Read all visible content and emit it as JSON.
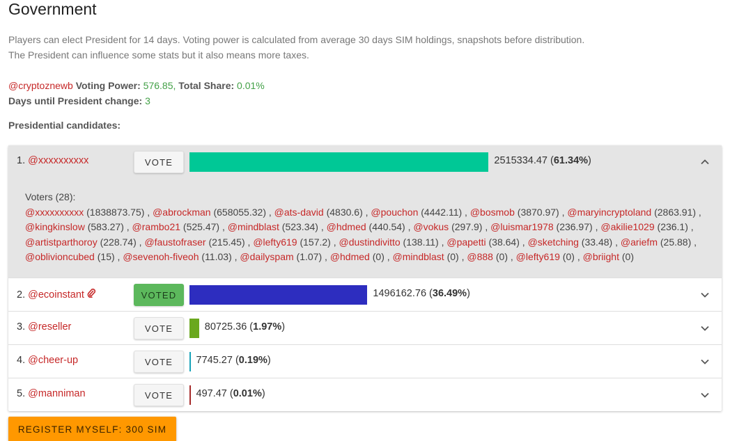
{
  "title": "Government",
  "description": {
    "line1": "Players can elect President for 14 days. Voting power is calculated from average 30 days SIM holdings, snapshots before distribution.",
    "line2": "The President can influence some stats but it also means more taxes."
  },
  "user": {
    "name": "@cryptoznewb",
    "voting_power_label": "Voting Power:",
    "voting_power": "576.85",
    "total_share_label": "Total Share:",
    "total_share": "0.01%",
    "days_label": "Days until President change:",
    "days": "3"
  },
  "candidates_label": "Presidential candidates:",
  "candidates": [
    {
      "rank": "1.",
      "name": "@xxxxxxxxxx",
      "button": "VOTE",
      "voted": false,
      "votes": "2515334.47",
      "pct": "61.34%",
      "share": 0.6134,
      "color": "#00c896",
      "expanded": true
    },
    {
      "rank": "2.",
      "name": "@ecoinstant",
      "button": "VOTED",
      "voted": true,
      "votes": "1496162.76",
      "pct": "36.49%",
      "share": 0.3649,
      "color": "#2d2dbf",
      "expanded": false,
      "icon": "paperclip-icon"
    },
    {
      "rank": "3.",
      "name": "@reseller",
      "button": "VOTE",
      "voted": false,
      "votes": "80725.36",
      "pct": "1.97%",
      "share": 0.0197,
      "color": "#6aa81e",
      "expanded": false
    },
    {
      "rank": "4.",
      "name": "@cheer-up",
      "button": "VOTE",
      "voted": false,
      "votes": "7745.27",
      "pct": "0.19%",
      "share": 0.0019,
      "color": "#17a2b8",
      "expanded": false
    },
    {
      "rank": "5.",
      "name": "@manniman",
      "button": "VOTE",
      "voted": false,
      "votes": "497.47",
      "pct": "0.01%",
      "share": 0.0001,
      "color": "#a52a2a",
      "expanded": false
    }
  ],
  "voters": {
    "label": "Voters (28):",
    "list": [
      [
        "@xxxxxxxxxx",
        "1838873.75"
      ],
      [
        "@abrockman",
        "658055.32"
      ],
      [
        "@ats-david",
        "4830.6"
      ],
      [
        "@pouchon",
        "4442.11"
      ],
      [
        "@bosmob",
        "3870.97"
      ],
      [
        "@maryincryptoland",
        "2863.91"
      ],
      [
        "@kingkinslow",
        "583.27"
      ],
      [
        "@rambo21",
        "525.47"
      ],
      [
        "@mindblast",
        "523.34"
      ],
      [
        "@hdmed",
        "440.54"
      ],
      [
        "@vokus",
        "297.9"
      ],
      [
        "@luismar1978",
        "236.97"
      ],
      [
        "@akilie1029",
        "236.1"
      ],
      [
        "@artistparthoroy",
        "228.74"
      ],
      [
        "@faustofraser",
        "215.45"
      ],
      [
        "@lefty619",
        "157.2"
      ],
      [
        "@dustindivitto",
        "138.11"
      ],
      [
        "@papetti",
        "38.64"
      ],
      [
        "@sketching",
        "33.48"
      ],
      [
        "@ariefm",
        "25.88"
      ],
      [
        "@oblivioncubed",
        "15"
      ],
      [
        "@sevenoh-fiveoh",
        "11.03"
      ],
      [
        "@dailyspam",
        "1.07"
      ],
      [
        "@hdmed",
        "0"
      ],
      [
        "@mindblast",
        "0"
      ],
      [
        "@888",
        "0"
      ],
      [
        "@lefty619",
        "0"
      ],
      [
        "@briight",
        "0"
      ]
    ]
  },
  "register_button": "REGISTER MYSELF: 300 SIM"
}
